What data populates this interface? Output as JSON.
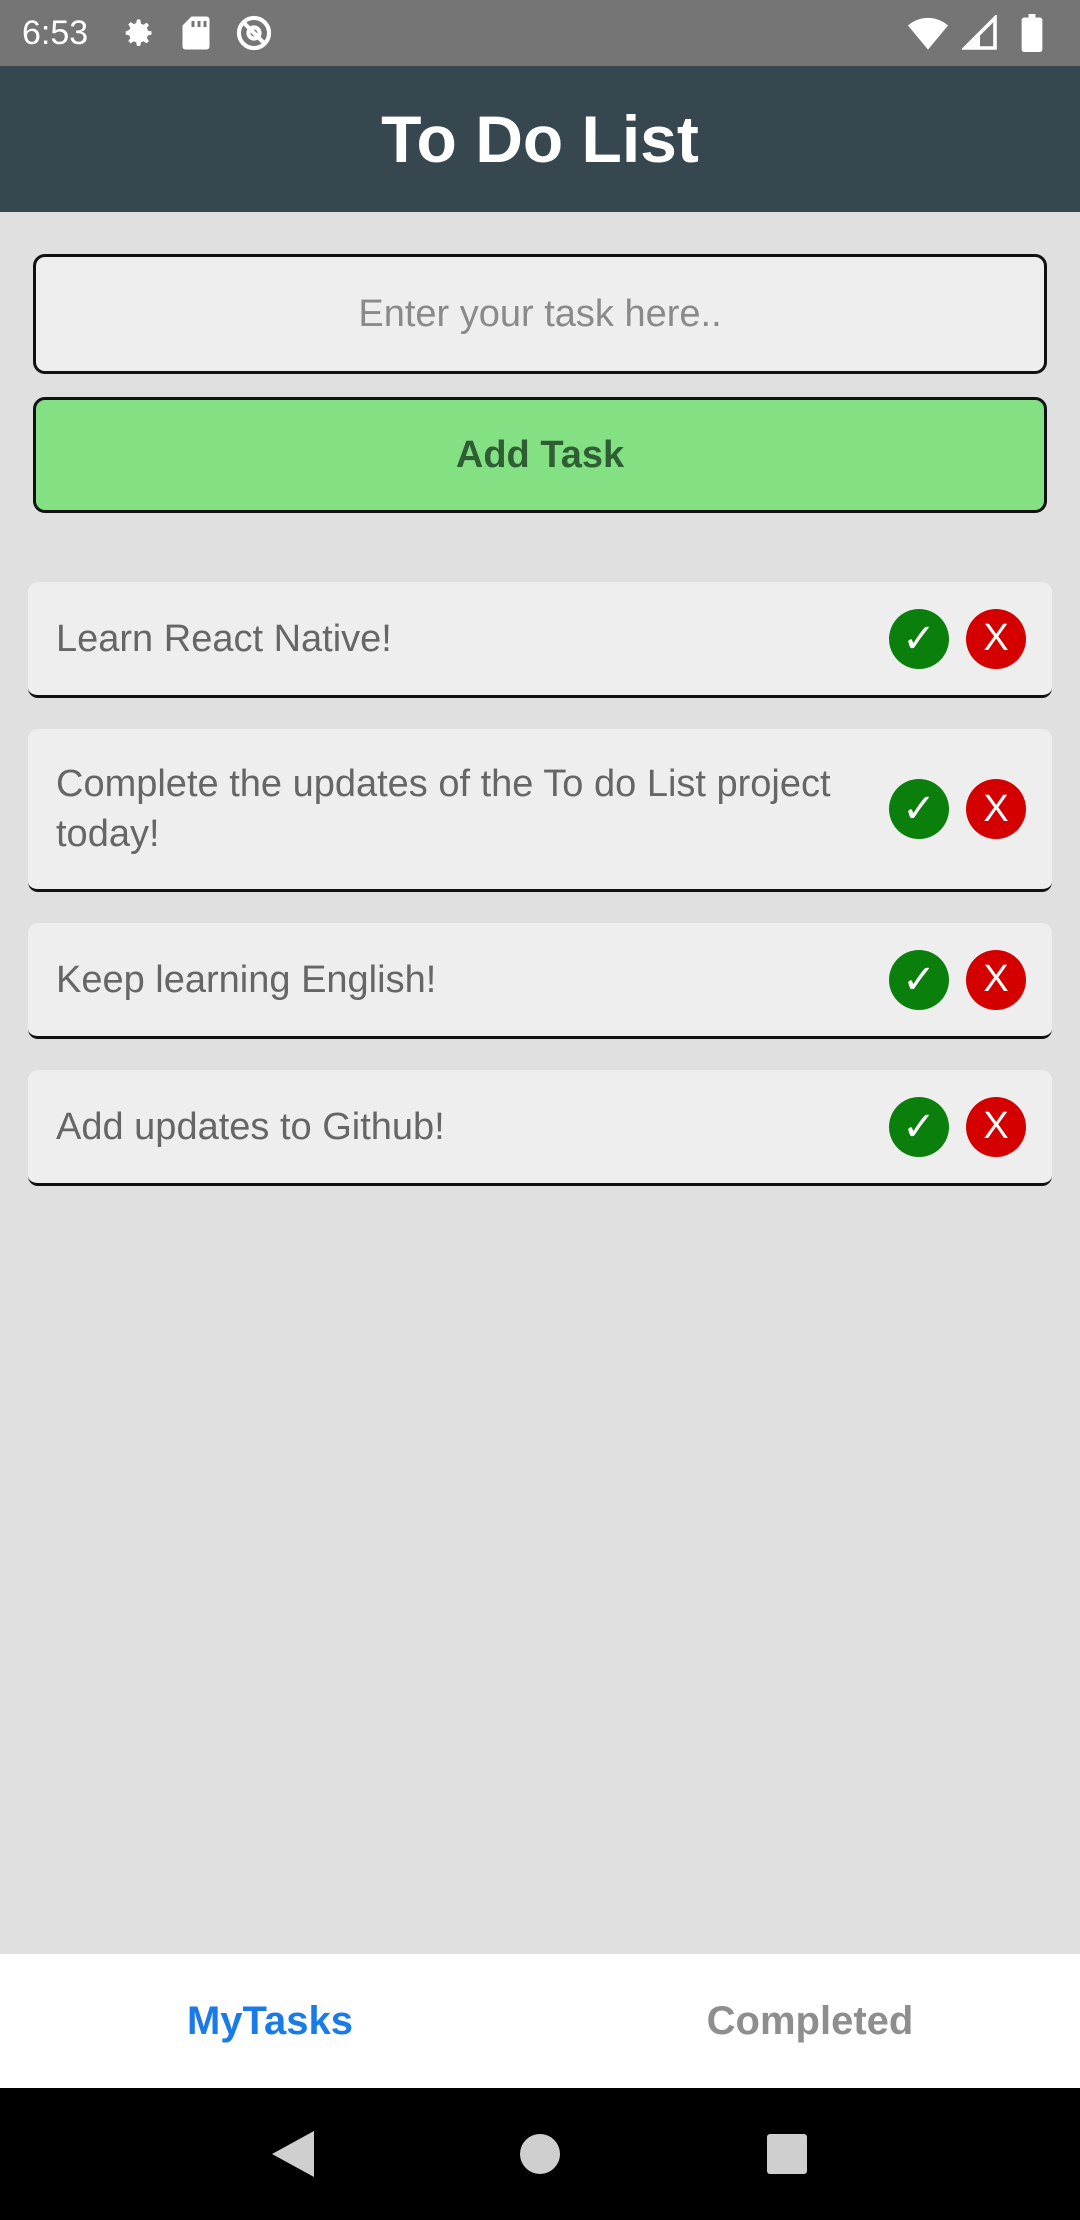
{
  "status_bar": {
    "time": "6:53",
    "left_icons": [
      "gear-icon",
      "sd-card-icon",
      "at-sign-icon"
    ],
    "right_icons": [
      "wifi-icon",
      "signal-icon",
      "battery-icon"
    ]
  },
  "header": {
    "title": "To Do List"
  },
  "input": {
    "value": "",
    "placeholder": "Enter your task here.."
  },
  "add_button": {
    "label": "Add Task"
  },
  "tasks": [
    {
      "text": "Learn React Native!",
      "complete_label": "✓",
      "delete_label": "X"
    },
    {
      "text": "Complete the updates of the To do List project today!",
      "complete_label": "✓",
      "delete_label": "X"
    },
    {
      "text": "Keep learning English!",
      "complete_label": "✓",
      "delete_label": "X"
    },
    {
      "text": "Add updates to Github!",
      "complete_label": "✓",
      "delete_label": "X"
    }
  ],
  "tabs": [
    {
      "label": "MyTasks",
      "active": true
    },
    {
      "label": "Completed",
      "active": false
    }
  ],
  "colors": {
    "header_bg": "#37474f",
    "add_button_bg": "#83e083",
    "complete_green": "#0b7f0b",
    "delete_red": "#d40000",
    "active_tab": "#1a7ae8"
  }
}
